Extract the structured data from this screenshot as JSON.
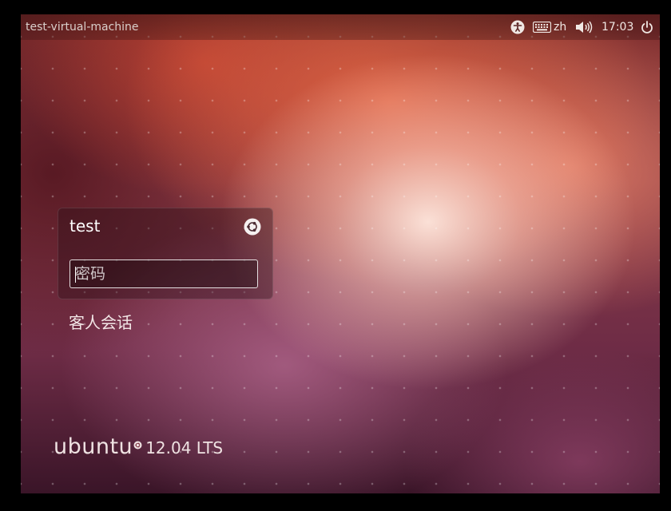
{
  "panel": {
    "hostname": "test-virtual-machine",
    "keyboard_layout": "zh",
    "clock": "17:03",
    "icons": {
      "accessibility": "accessibility-icon",
      "keyboard": "keyboard-icon",
      "volume": "volume-icon",
      "power": "power-icon"
    }
  },
  "login": {
    "username": "test",
    "session_icon": "ubuntu-session-icon",
    "password_placeholder": "密码",
    "password_value": ""
  },
  "guest_session": "客人会话",
  "branding": {
    "wordmark": "ubuntu",
    "version": "12.04 LTS"
  },
  "colors": {
    "background_accent": "#e7683f",
    "panel_text": "#f0e8e4"
  }
}
